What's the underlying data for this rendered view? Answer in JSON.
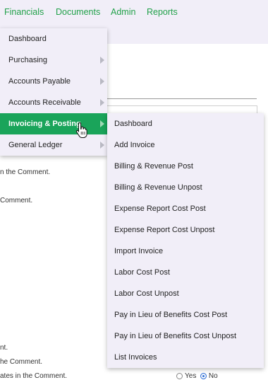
{
  "nav": {
    "items": [
      {
        "label": "Financials"
      },
      {
        "label": "Documents"
      },
      {
        "label": "Admin"
      },
      {
        "label": "Reports"
      }
    ]
  },
  "background": {
    "lines": [
      "n the Comment.",
      " Comment.",
      "nt.",
      "he Comment.",
      "ates in the Comment."
    ],
    "radio_yes": "Yes",
    "radio_no": "No",
    "radio_selected": "No"
  },
  "financials_menu": {
    "items": [
      {
        "label": "Dashboard",
        "submenu": false
      },
      {
        "label": "Purchasing",
        "submenu": true
      },
      {
        "label": "Accounts Payable",
        "submenu": true
      },
      {
        "label": "Accounts Receivable",
        "submenu": true
      },
      {
        "label": "Invoicing & Posting",
        "submenu": true,
        "active": true
      },
      {
        "label": "General Ledger",
        "submenu": true
      }
    ]
  },
  "invoicing_submenu": {
    "items": [
      {
        "label": "Dashboard"
      },
      {
        "label": "Add Invoice"
      },
      {
        "label": "Billing & Revenue Post"
      },
      {
        "label": "Billing & Revenue Unpost"
      },
      {
        "label": "Expense Report Cost Post"
      },
      {
        "label": "Expense Report Cost Unpost"
      },
      {
        "label": "Import Invoice"
      },
      {
        "label": "Labor Cost Post"
      },
      {
        "label": "Labor Cost Unpost"
      },
      {
        "label": "Pay in Lieu of Benefits Cost Post"
      },
      {
        "label": "Pay in Lieu of Benefits Cost Unpost"
      },
      {
        "label": "List Invoices"
      }
    ]
  },
  "colors": {
    "accent": "#22a14a",
    "active_bg": "#1aa45a",
    "menu_bg": "#f1eef8"
  },
  "icons": {
    "cursor": "hand-pointer-icon",
    "submenu": "chevron-right-icon"
  }
}
